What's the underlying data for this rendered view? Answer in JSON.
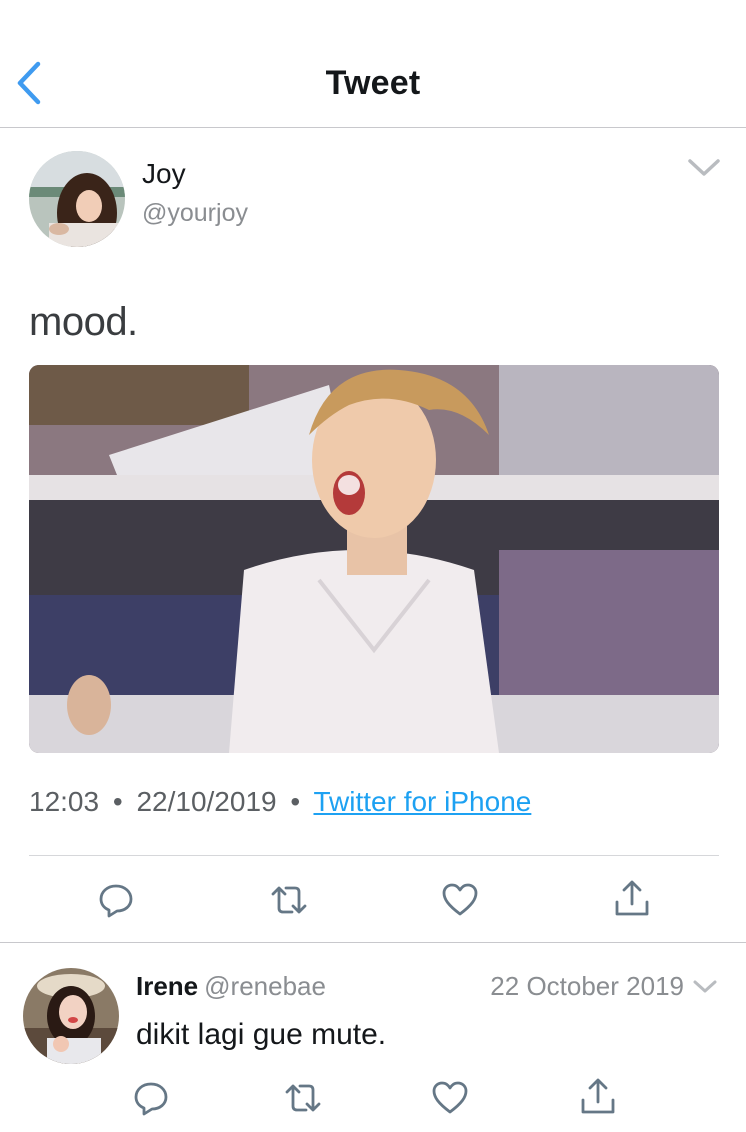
{
  "nav": {
    "title": "Tweet",
    "back_icon": "chevron-left-icon"
  },
  "tweet": {
    "author_name": "Joy",
    "author_handle": "@yourjoy",
    "text": "mood.",
    "time": "12:03",
    "date": "22/10/2019",
    "separator": "•",
    "source": "Twitter for iPhone",
    "media_icon": "photo"
  },
  "actions": [
    "reply-icon",
    "retweet-icon",
    "like-icon",
    "share-icon"
  ],
  "reply": {
    "author_name": "Irene",
    "author_handle": "@renebae",
    "date": "22 October 2019",
    "text": "dikit lagi gue mute."
  },
  "colors": {
    "accent": "#1da1f2",
    "back": "#1da1f2",
    "icon": "#657786",
    "text": "#14171a",
    "muted": "#8a8d91"
  }
}
